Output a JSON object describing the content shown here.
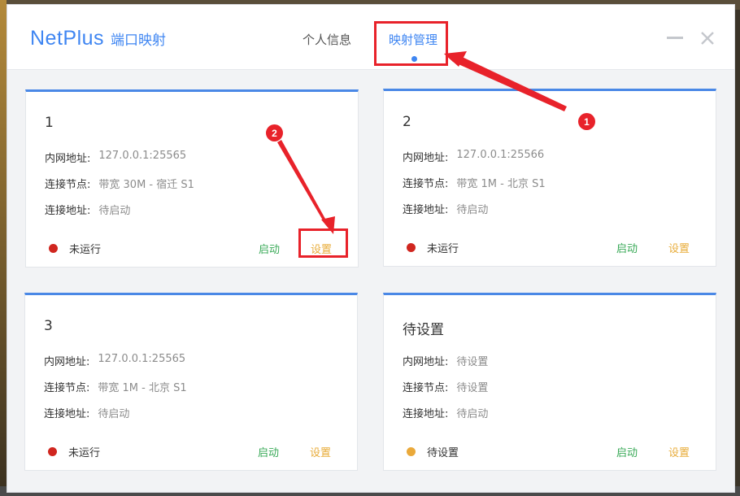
{
  "header": {
    "brand_name": "NetPlus",
    "brand_sub": "端口映射",
    "tabs": [
      {
        "label": "个人信息",
        "active": false
      },
      {
        "label": "映射管理",
        "active": true
      }
    ]
  },
  "labels": {
    "lan_addr": "内网地址:",
    "node": "连接节点:",
    "conn_addr": "连接地址:",
    "start": "启动",
    "settings": "设置"
  },
  "cards": [
    {
      "title": "1",
      "lan_addr": "127.0.0.1:25565",
      "node": "带宽 30M - 宿迁 S1",
      "conn_addr": "待启动",
      "status": "未运行",
      "status_color": "#d0261f"
    },
    {
      "title": "2",
      "lan_addr": "127.0.0.1:25566",
      "node": "带宽 1M - 北京 S1",
      "conn_addr": "待启动",
      "status": "未运行",
      "status_color": "#d0261f"
    },
    {
      "title": "3",
      "lan_addr": "127.0.0.1:25565",
      "node": "带宽 1M - 北京 S1",
      "conn_addr": "待启动",
      "status": "未运行",
      "status_color": "#d0261f"
    },
    {
      "title": "待设置",
      "lan_addr": "待设置",
      "node": "待设置",
      "conn_addr": "待启动",
      "status": "待设置",
      "status_color": "#eaa93a"
    }
  ],
  "annotations": [
    {
      "number": "1"
    },
    {
      "number": "2"
    }
  ],
  "colors": {
    "accent": "#3f86f2",
    "start_green": "#3aaa58",
    "settings_orange": "#e8ac3a",
    "annotation_red": "#e8222a"
  }
}
